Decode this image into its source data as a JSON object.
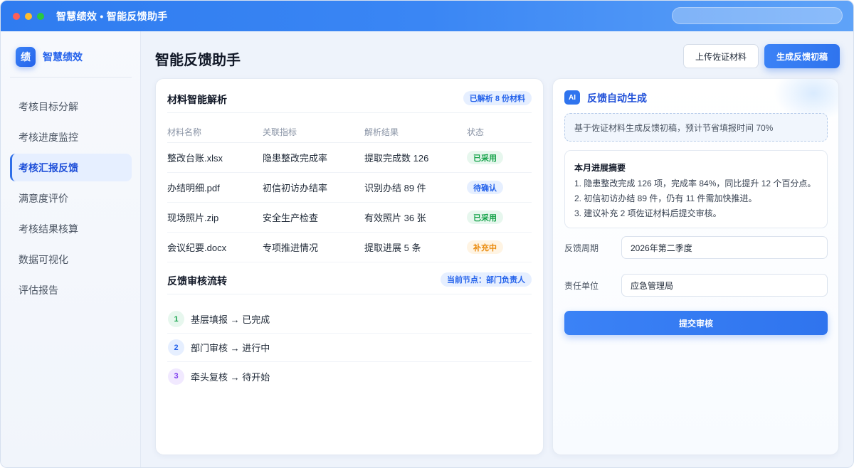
{
  "window": {
    "title": "智慧绩效 • 智能反馈助手"
  },
  "sidebar": {
    "brand_logo": "绩",
    "brand_name": "智慧绩效",
    "items": [
      {
        "label": "考核目标分解"
      },
      {
        "label": "考核进度监控"
      },
      {
        "label": "考核汇报反馈",
        "active": true
      },
      {
        "label": "满意度评价"
      },
      {
        "label": "考核结果核算"
      },
      {
        "label": "数据可视化"
      },
      {
        "label": "评估报告"
      }
    ]
  },
  "header": {
    "title": "智能反馈助手",
    "upload_label": "上传佐证材料",
    "generate_label": "生成反馈初稿"
  },
  "materials": {
    "title": "材料智能解析",
    "badge": "已解析 8 份材料",
    "columns": [
      "材料名称",
      "关联指标",
      "解析结果",
      "状态"
    ],
    "rows": [
      {
        "name": "整改台账.xlsx",
        "indicator": "隐患整改完成率",
        "result": "提取完成数 126",
        "status": "已采用",
        "status_color": "#16a34a",
        "status_bg": "#e7f7ee"
      },
      {
        "name": "办结明细.pdf",
        "indicator": "初信初访办结率",
        "result": "识别办结 89 件",
        "status": "待确认",
        "status_color": "#2563eb",
        "status_bg": "#e6efff"
      },
      {
        "name": "现场照片.zip",
        "indicator": "安全生产检查",
        "result": "有效照片 36 张",
        "status": "已采用",
        "status_color": "#16a34a",
        "status_bg": "#e7f7ee"
      },
      {
        "name": "会议纪要.docx",
        "indicator": "专项推进情况",
        "result": "提取进展 5 条",
        "status": "补充中",
        "status_color": "#ea8a0c",
        "status_bg": "#fff4e3"
      }
    ]
  },
  "workflow": {
    "title": "反馈审核流转",
    "badge": "当前节点：部门负责人",
    "steps": [
      {
        "num": "1",
        "text": "基层填报 → 已完成",
        "color": "#16a34a",
        "bg": "#e7f7ee"
      },
      {
        "num": "2",
        "text": "部门审核 → 进行中",
        "color": "#2563eb",
        "bg": "#e6efff"
      },
      {
        "num": "3",
        "text": "牵头复核 → 待开始",
        "color": "#7c3aed",
        "bg": "#f1e9ff"
      }
    ]
  },
  "ai_panel": {
    "badge": "AI",
    "title": "反馈自动生成",
    "hint": "基于佐证材料生成反馈初稿，预计节省填报时间 70%",
    "summary_title": "本月进展摘要",
    "summary_lines": [
      "1. 隐患整改完成 126 项，完成率 84%，同比提升 12 个百分点。",
      "2. 初信初访办结 89 件，仍有 11 件需加快推进。",
      "3. 建议补充 2 项佐证材料后提交审核。"
    ],
    "period_label": "反馈周期",
    "period_value": "2026年第二季度",
    "unit_label": "责任单位",
    "unit_value": "应急管理局",
    "submit_label": "提交审核"
  }
}
